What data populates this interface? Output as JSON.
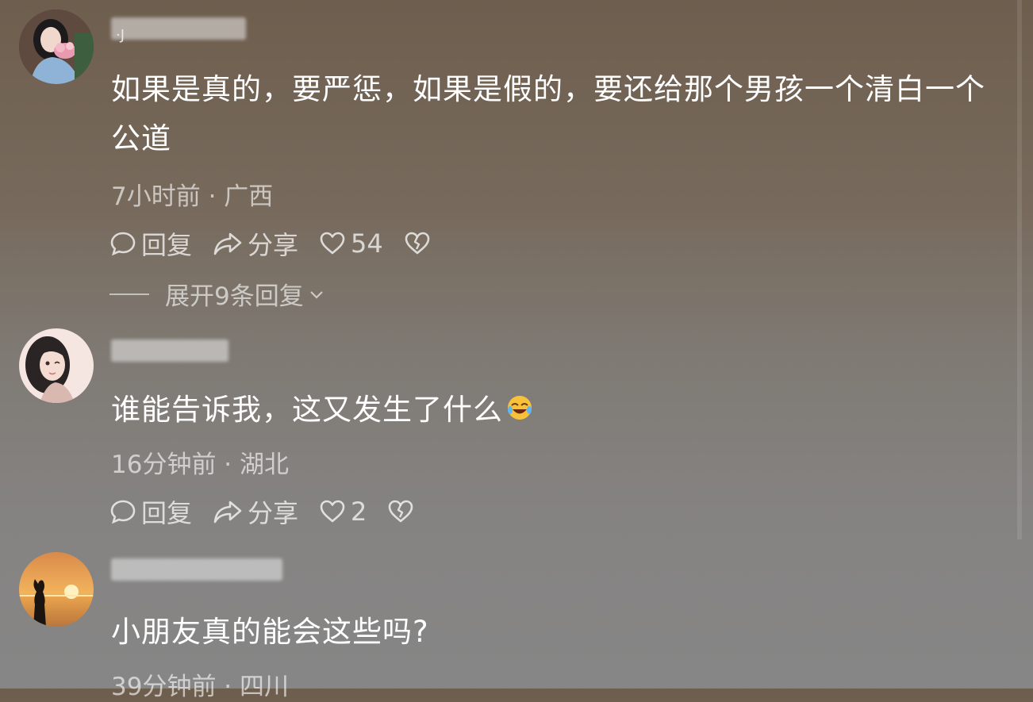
{
  "comments": [
    {
      "username_mark": "·J",
      "text": "如果是真的，要严惩，如果是假的，要还给那个男孩一个清白一个公道",
      "meta": "7小时前 · 广西",
      "reply_label": "回复",
      "share_label": "分享",
      "like_count": "54",
      "expand_label": "展开9条回复"
    },
    {
      "text": "谁能告诉我，这又发生了什么",
      "meta": "16分钟前 · 湖北",
      "reply_label": "回复",
      "share_label": "分享",
      "like_count": "2"
    },
    {
      "text": "小朋友真的能会这些吗?",
      "meta": "39分钟前 · 四川"
    }
  ],
  "icons": {
    "reply": "comment-bubble-icon",
    "share": "share-arrow-icon",
    "like": "heart-icon",
    "dislike": "broken-heart-icon",
    "emoji": "laughing-tears-emoji",
    "expand": "chevron-down-icon"
  },
  "colors": {
    "text": "#ffffff",
    "meta": "#c9c6c2"
  }
}
